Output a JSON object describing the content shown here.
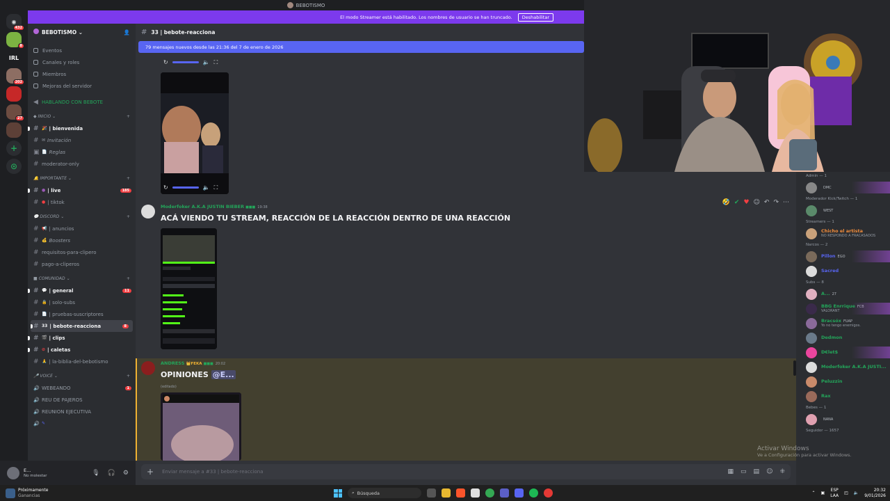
{
  "window": {
    "title": "BEBOTISMO"
  },
  "banner": {
    "text": "El modo Streamer está habilitado. Los nombres de usuario se han truncado.",
    "button": "Deshabilitar"
  },
  "rail": {
    "badges": [
      "432",
      "8",
      "202",
      "27"
    ],
    "labels": {
      "irl": "IRL"
    }
  },
  "server": {
    "name": "BEBOTISMO"
  },
  "sidebar": {
    "nav": [
      "Eventos",
      "Canales y roles",
      "Miembros",
      "Mejoras del servidor"
    ],
    "special_channel": "HABLANDO CON BEBOTE",
    "categories": {
      "inicio": "INICIO",
      "importante": "IMPORTANTE",
      "discord": "DISCORD",
      "comunidad": "COMUNIDAD",
      "voice": "VOICE"
    },
    "inicio": [
      {
        "name": "| bienvenida",
        "unread": true
      },
      {
        "name": "Invitación",
        "italic": true
      },
      {
        "name": "Reglas",
        "italic": true
      },
      {
        "name": "moderator-only"
      }
    ],
    "importante": [
      {
        "name": "| live",
        "count": "185"
      },
      {
        "name": "| tiktok"
      }
    ],
    "discord": [
      {
        "name": "| anuncios"
      },
      {
        "name": "Boosters",
        "italic": true
      },
      {
        "name": "requisitos-para-clipero"
      },
      {
        "name": "pago-a-cliperos"
      }
    ],
    "comunidad": [
      {
        "name": "| general",
        "count": "11"
      },
      {
        "name": "| solo-subs"
      },
      {
        "name": "| pruebas-suscriptores"
      },
      {
        "name": "| bebote-reacciona",
        "count": "8"
      },
      {
        "name": "| clips"
      },
      {
        "name": "| caletas"
      },
      {
        "name": "| la-biblia-del-bebotismo"
      }
    ],
    "voice": [
      {
        "name": "WEBEANDO",
        "count": "1"
      },
      {
        "name": "REU DE PAJEROS"
      },
      {
        "name": "REUNION EJECUTIVA"
      },
      {
        "name": ""
      }
    ]
  },
  "user": {
    "name": "E...",
    "status": "No molestar"
  },
  "chat": {
    "channel": "33 | bebote-reacciona",
    "new_messages": "79 mensajes nuevos desde las 21:36 del 7 de enero de 2026",
    "messages": [
      {
        "author": "Moderfoker A.K.A JUSTIN BIEBER",
        "time": "19:38",
        "text": "ACÁ VIENDO TU STREAM, REACCIÓN DE LA REACCIÓN DENTRO DE UNA REACCIÓN"
      },
      {
        "author": "ANDRESS",
        "badge": "FEKA",
        "time": "20:02",
        "text": "OPINIONES",
        "mention": "@E...",
        "edited": "(editado)"
      }
    ],
    "input_placeholder": "Enviar mensaje a #33 | bebote-reacciona"
  },
  "members": {
    "groups": [
      {
        "title": "Admin — 1",
        "users": [
          {
            "name": "",
            "tag": "DMC"
          }
        ]
      },
      {
        "title": "Moderador Kick/Twitch — 1",
        "users": [
          {
            "name": "",
            "tag": "WEST"
          }
        ]
      },
      {
        "title": "Streamers — 1",
        "users": [
          {
            "name": "Chicho el artista",
            "sub": "NO RESPONDO A FRACASADOS"
          }
        ]
      },
      {
        "title": "Narcos — 2",
        "users": [
          {
            "name": "Pillon",
            "tag": "EGO"
          },
          {
            "name": "Sacred"
          }
        ]
      },
      {
        "title": "Subs — 8",
        "users": [
          {
            "name": "A...",
            "tag": "27"
          },
          {
            "name": "BBG Enrrique",
            "tag": "FCB",
            "sub": "VALORANT"
          },
          {
            "name": "Bracsóx",
            "tag": "FUAP",
            "sub": "Yo no tengo enemigos."
          },
          {
            "name": "Dedmon"
          },
          {
            "name": "D€let$"
          },
          {
            "name": "Moderfoker A.K.A JUSTI..."
          },
          {
            "name": "Peluzzin"
          },
          {
            "name": "Rax"
          }
        ]
      },
      {
        "title": "Bebes — 1",
        "users": [
          {
            "name": "",
            "tag": "NANA"
          }
        ]
      },
      {
        "title": "Seguidor — 1657",
        "users": []
      }
    ]
  },
  "watermark": {
    "title": "Activar Windows",
    "sub": "Ve a Configuración para activar Windows."
  },
  "taskbar": {
    "weather_title": "Próximamente",
    "weather_sub": "Ganancias",
    "search": "Búsqueda",
    "lang": "ESP",
    "lang2": "LAA",
    "time": "20:32",
    "date": "9/01/2026"
  },
  "colors": {
    "accent": "#5865f2",
    "banner": "#7c3aed",
    "green": "#23a55a",
    "red": "#f23f42",
    "highlight": "#f0b232"
  }
}
